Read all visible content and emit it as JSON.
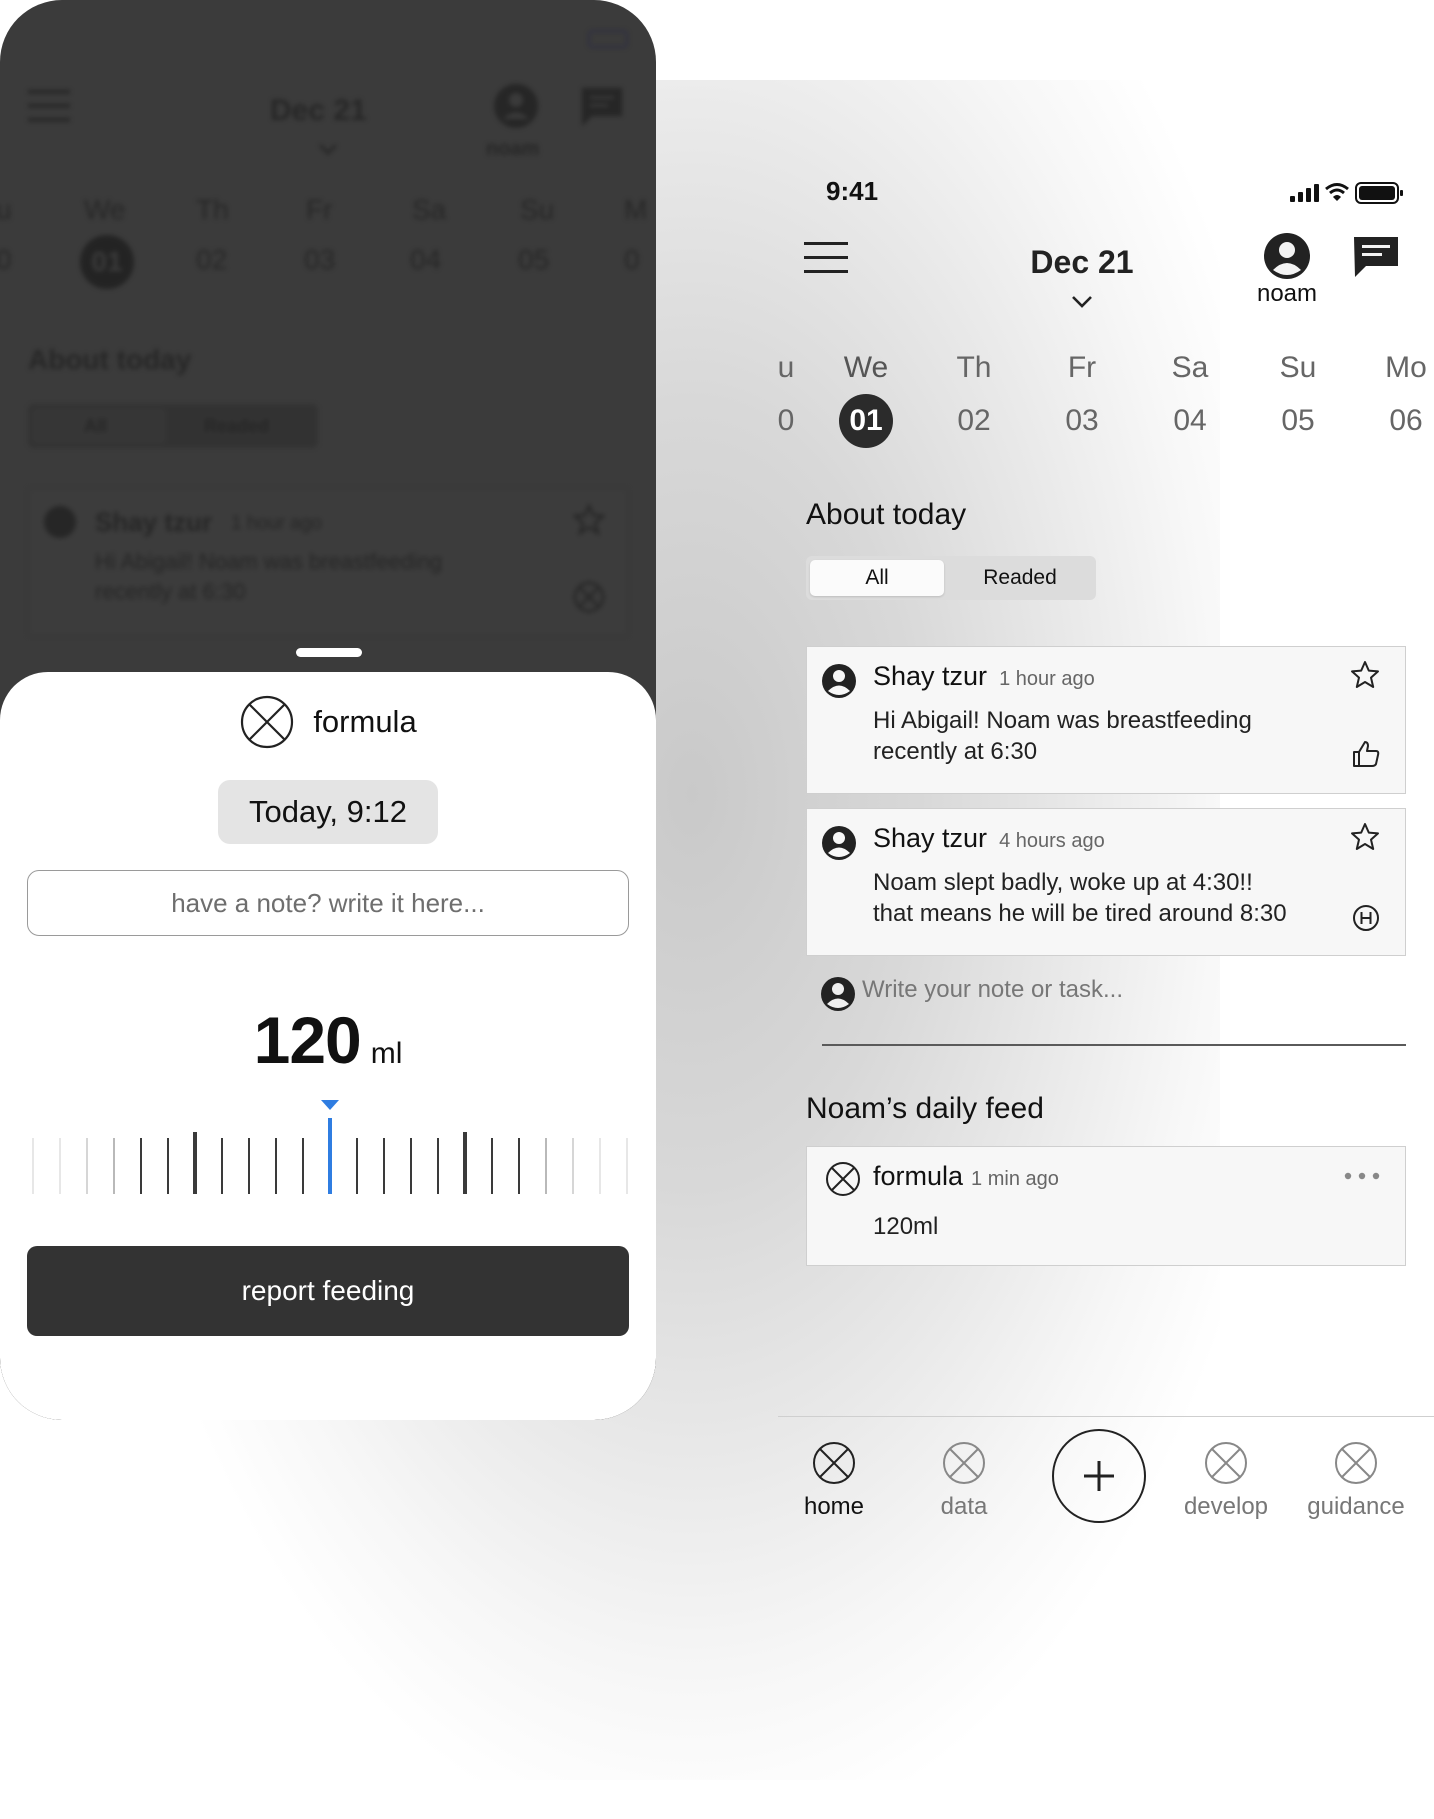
{
  "colors": {
    "accent": "#2f7de1",
    "dark": "#333333",
    "overlay": "#3b3b3b"
  },
  "modal": {
    "title": "formula",
    "title_icon": "circle-x-icon",
    "time": "Today, 9:12",
    "note_placeholder": "have a note? write it here...",
    "amount": "120",
    "unit": "ml",
    "submit": "report feeding"
  },
  "background_screen": {
    "date": "Dec 21",
    "user": "noam",
    "days": [
      {
        "name": "u",
        "num": "0"
      },
      {
        "name": "We",
        "num": "01"
      },
      {
        "name": "Th",
        "num": "02"
      },
      {
        "name": "Fr",
        "num": "03"
      },
      {
        "name": "Sa",
        "num": "04"
      },
      {
        "name": "Su",
        "num": "05"
      },
      {
        "name": "M",
        "num": "0"
      }
    ],
    "section": "About today",
    "filter_all": "All",
    "filter_read": "Readed",
    "card_author": "Shay tzur",
    "card_time": "1 hour ago",
    "card_text_1": "Hi Abigail! Noam was breastfeeding",
    "card_text_2": "recently at 6:30"
  },
  "status_bar": {
    "time": "9:41"
  },
  "header": {
    "date": "Dec 21",
    "user": "noam"
  },
  "week": {
    "selected_index": 1,
    "days": [
      {
        "name": "u",
        "num": "0"
      },
      {
        "name": "We",
        "num": "01"
      },
      {
        "name": "Th",
        "num": "02"
      },
      {
        "name": "Fr",
        "num": "03"
      },
      {
        "name": "Sa",
        "num": "04"
      },
      {
        "name": "Su",
        "num": "05"
      },
      {
        "name": "Mo",
        "num": "06"
      }
    ]
  },
  "about": {
    "title": "About today",
    "filters": [
      {
        "label": "All",
        "active": true
      },
      {
        "label": "Readed",
        "active": false
      }
    ],
    "notes": [
      {
        "author": "Shay tzur",
        "time": "1 hour ago",
        "lines": [
          "Hi Abigail! Noam was breastfeeding",
          "recently at 6:30"
        ],
        "action_icon": "thumbs-up-icon"
      },
      {
        "author": "Shay tzur",
        "time": "4 hours ago",
        "lines": [
          "Noam slept badly, woke up at 4:30!!",
          "that means he will be tired around 8:30"
        ],
        "action_icon": "h-circle-icon"
      }
    ],
    "compose_placeholder": "Write your note or task..."
  },
  "feed": {
    "title": "Noam’s daily feed",
    "items": [
      {
        "title": "formula",
        "time": "1 min ago",
        "value": "120ml"
      }
    ]
  },
  "tabs": [
    {
      "label": "home",
      "active": true
    },
    {
      "label": "data",
      "active": false
    },
    {
      "label": "develop",
      "active": false
    },
    {
      "label": "guidance",
      "active": false
    }
  ]
}
